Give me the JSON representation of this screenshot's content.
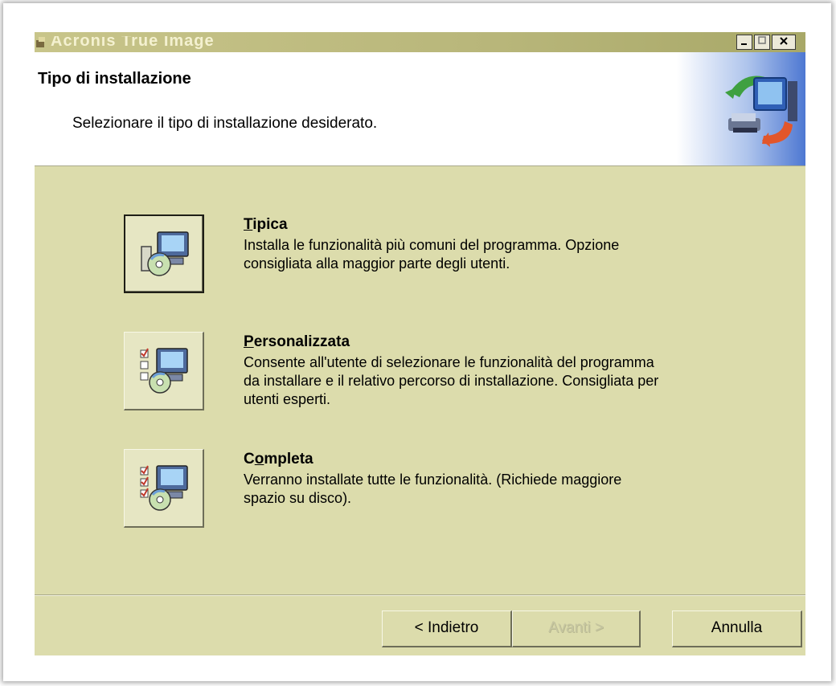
{
  "window": {
    "title": "Acronis True Image",
    "controls": [
      "minimize",
      "maximize",
      "close"
    ]
  },
  "header": {
    "title": "Tipo di installazione",
    "subtitle": "Selezionare il tipo di installazione desiderato.",
    "icon": "computer-install-icon"
  },
  "options": [
    {
      "title": "Tipica",
      "mnemonic": "T",
      "description_lines": [
        "Installa le funzionalità più comuni del programma. Opzione",
        "consigliata alla maggior parte degli utenti."
      ],
      "icon": "typical-install-icon",
      "selected": true
    },
    {
      "title": "Personalizzata",
      "mnemonic": "P",
      "description_lines": [
        "Consente all'utente di selezionare le funzionalità del programma",
        "da installare e il relativo percorso di installazione. Consigliata per",
        "utenti esperti."
      ],
      "icon": "custom-install-icon",
      "selected": false
    },
    {
      "title": "Completa",
      "mnemonic": "o",
      "description_lines": [
        "Verranno installate tutte le funzionalità. (Richiede maggiore",
        "spazio su disco)."
      ],
      "icon": "complete-install-icon",
      "selected": false
    }
  ],
  "footer": {
    "back_label": "< Indietro",
    "next_label": "Avanti >",
    "next_enabled": false,
    "cancel_label": "Annulla"
  },
  "colors": {
    "dialog_bg": "#dcdcac",
    "header_bg": "#ffffff",
    "header_gradient_end": "#4e78d2"
  }
}
